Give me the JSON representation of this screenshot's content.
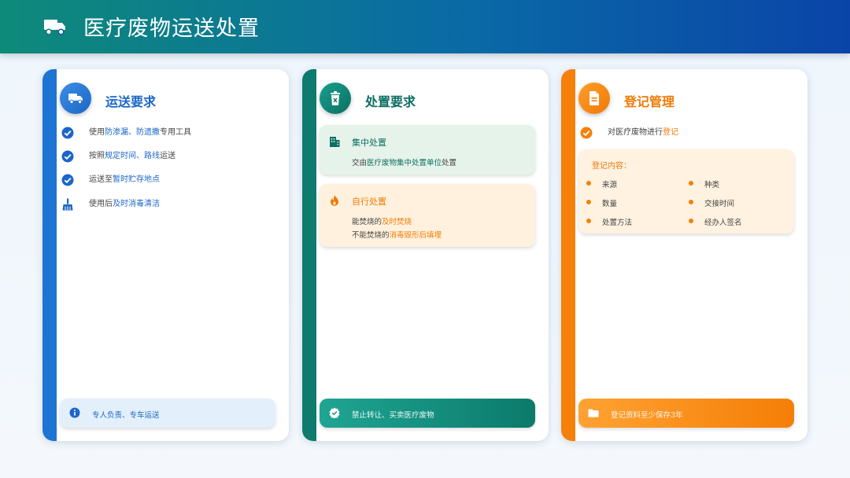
{
  "header": {
    "title": "医疗废物运送处置",
    "icon": "truck-icon"
  },
  "colors": {
    "blue": "#1c66c8",
    "green": "#0c6f62",
    "orange": "#f07a05"
  },
  "transport": {
    "title": "运送要求",
    "items": [
      {
        "pre": "使用",
        "hl": "防渗漏、防遗撒",
        "post": "专用工具"
      },
      {
        "pre": "按照",
        "hl": "规定时间、路线",
        "post": "运送"
      },
      {
        "pre": "运送至",
        "hl": "暂时贮存地点",
        "post": ""
      },
      {
        "pre": "使用后",
        "hl": "及时消毒清洁",
        "post": ""
      }
    ],
    "footer": "专人负责、专车运送"
  },
  "disposal": {
    "title": "处置要求",
    "central": {
      "title": "集中处置",
      "pre": "交由",
      "hl": "医疗废物集中处置单位",
      "post": "处置"
    },
    "self": {
      "title": "自行处置",
      "line1_pre": "能焚烧的",
      "line1_hl": "及时焚烧",
      "line2_pre": "不能焚烧的",
      "line2_hl": "消毒毁形后填埋"
    },
    "footer": "禁止转让、买卖医疗废物"
  },
  "registration": {
    "title": "登记管理",
    "item_pre": "对医疗废物进行",
    "item_hl": "登记",
    "box_title": "登记内容：",
    "fields": [
      "来源",
      "种类",
      "数量",
      "交接时间",
      "处置方法",
      "经办人签名"
    ],
    "footer": "登记资料至少保存3年"
  }
}
